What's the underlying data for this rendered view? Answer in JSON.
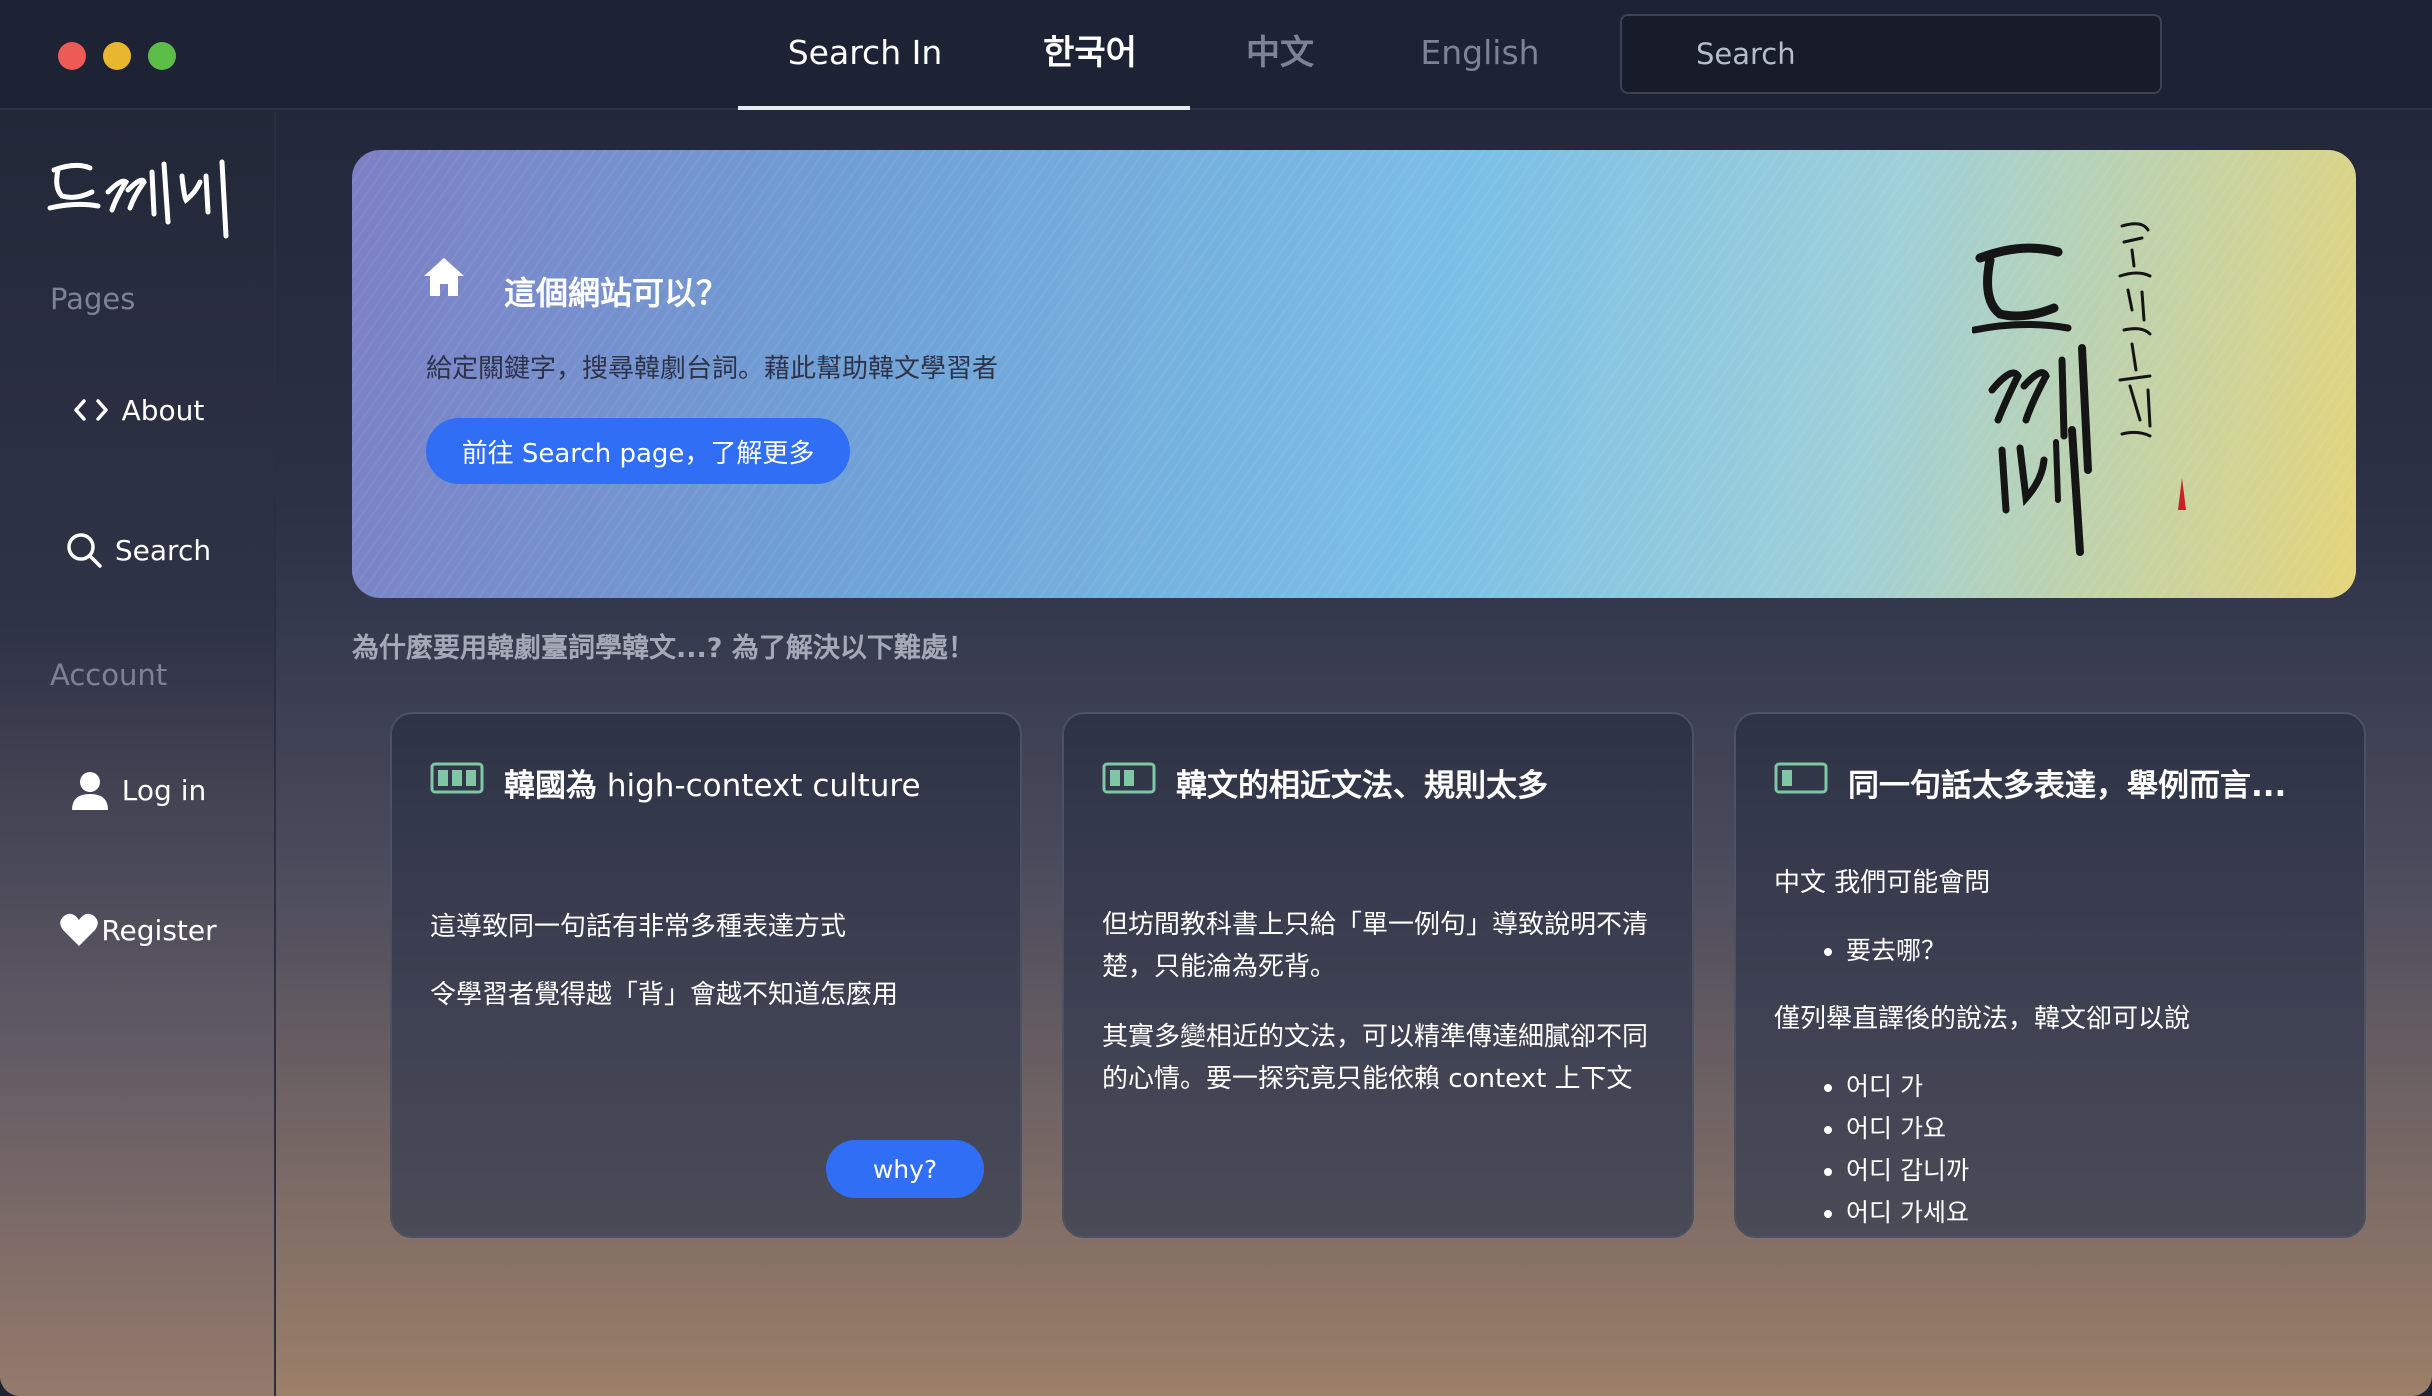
{
  "topbar": {
    "tabs": [
      {
        "label": "Search In"
      },
      {
        "label": "한국어"
      },
      {
        "label": "中文"
      },
      {
        "label": "English"
      }
    ],
    "search_placeholder": "Search"
  },
  "sidebar": {
    "logo_text": "도깨비",
    "section_pages": "Pages",
    "section_account": "Account",
    "items": [
      {
        "label": "About",
        "icon": "code-icon"
      },
      {
        "label": "Search",
        "icon": "search-icon"
      },
      {
        "label": "Log in",
        "icon": "user-icon"
      },
      {
        "label": "Register",
        "icon": "heart-icon"
      }
    ]
  },
  "hero": {
    "title": "這個網站可以？",
    "description": "給定關鍵字，搜尋韓劇台詞。藉此幫助韓文學習者",
    "button_label": "前往 Search page，了解更多",
    "art_title": "도깨비"
  },
  "why_heading": "為什麼要用韓劇臺詞學韓文...? 為了解決以下難處！",
  "cards": [
    {
      "title_bold": "韓國為",
      "title_light": " high-context culture",
      "paragraphs": [
        "這導致同一句話有非常多種表達方式",
        "令學習者覺得越「背」會越不知道怎麼用"
      ],
      "button_label": "why?",
      "icon": "battery-full-icon"
    },
    {
      "title_bold": "韓文的相近文法、規則太多",
      "paragraphs": [
        "但坊間教科書上只給「單一例句」導致說明不清楚，只能淪為死背。",
        "其實多變相近的文法，可以精準傳達細膩卻不同的心情。要一探究竟只能依賴 context 上下文"
      ],
      "icon": "battery-half-icon"
    },
    {
      "title_bold": "同一句話太多表達，舉例而言...",
      "intro": "中文 我們可能會問",
      "zh_examples": [
        "要去哪？"
      ],
      "middle": "僅列舉直譯後的說法，韓文卻可以說",
      "ko_examples": [
        "어디 가",
        "어디 가요",
        "어디 갑니까",
        "어디 가세요"
      ],
      "icon": "battery-low-icon"
    }
  ],
  "colors": {
    "accent_button": "#2f6ef5",
    "topbar_bg": "#1d2234",
    "icon_green": "#7fc6a4"
  }
}
